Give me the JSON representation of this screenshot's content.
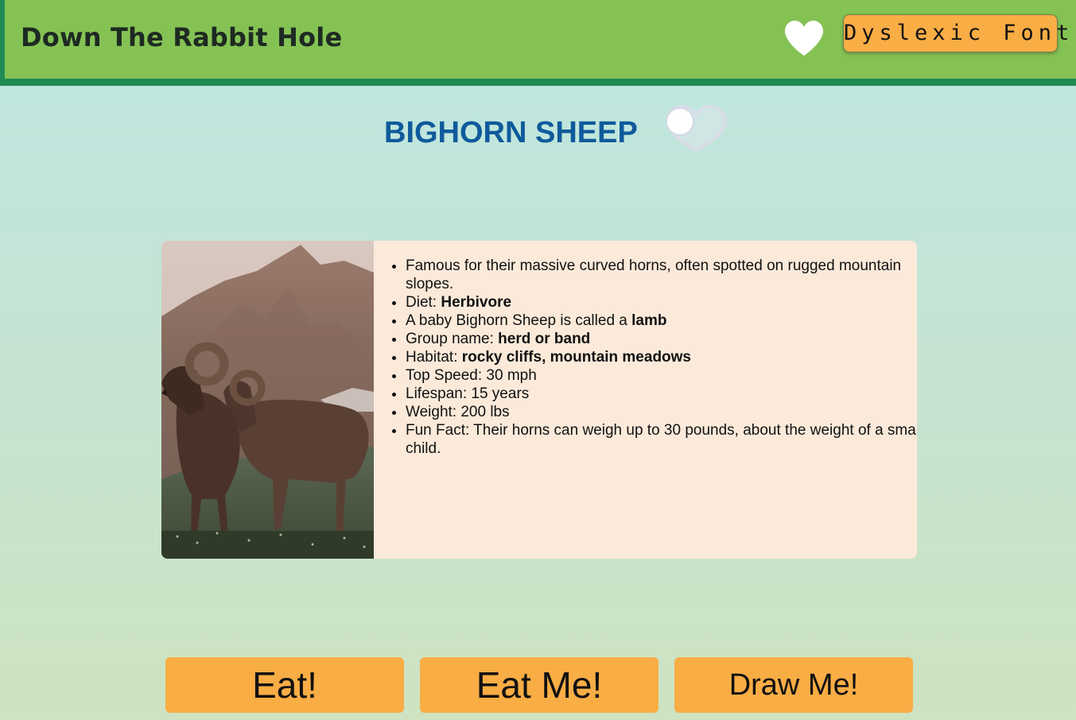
{
  "header": {
    "title": "Down The Rabbit Hole",
    "favorite_icon": "heart-icon",
    "dyslexic_button_label": "Dyslexic Font"
  },
  "animal": {
    "name": "BIGHORN SHEEP",
    "favorite_toggle_icon": "heart-toggle-icon",
    "photo_icon": "bighorn-sheep-photo"
  },
  "facts": [
    {
      "prefix": "Famous for their massive curved horns, often spotted on rugged mountain slopes.",
      "bold": ""
    },
    {
      "prefix": "Diet: ",
      "bold": "Herbivore"
    },
    {
      "prefix": "A baby Bighorn Sheep is called a ",
      "bold": "lamb"
    },
    {
      "prefix": "Group name: ",
      "bold": "herd or band"
    },
    {
      "prefix": "Habitat: ",
      "bold": "rocky cliffs, mountain meadows"
    },
    {
      "prefix": "Top Speed: 30 mph",
      "bold": ""
    },
    {
      "prefix": "Lifespan: 15 years",
      "bold": ""
    },
    {
      "prefix": "Weight: 200 lbs",
      "bold": ""
    },
    {
      "prefix": "Fun Fact: Their horns can weigh up to 30 pounds, about the weight of a small child.",
      "bold": ""
    }
  ],
  "actions": {
    "eat_label": "Eat!",
    "eat_me_label": "Eat Me!",
    "draw_me_label": "Draw Me!"
  },
  "colors": {
    "header_bg": "#85c254",
    "header_border": "#1f8a55",
    "button_orange": "#f9ad45",
    "title_blue": "#0f5a9c",
    "card_bg": "#fbeada"
  }
}
